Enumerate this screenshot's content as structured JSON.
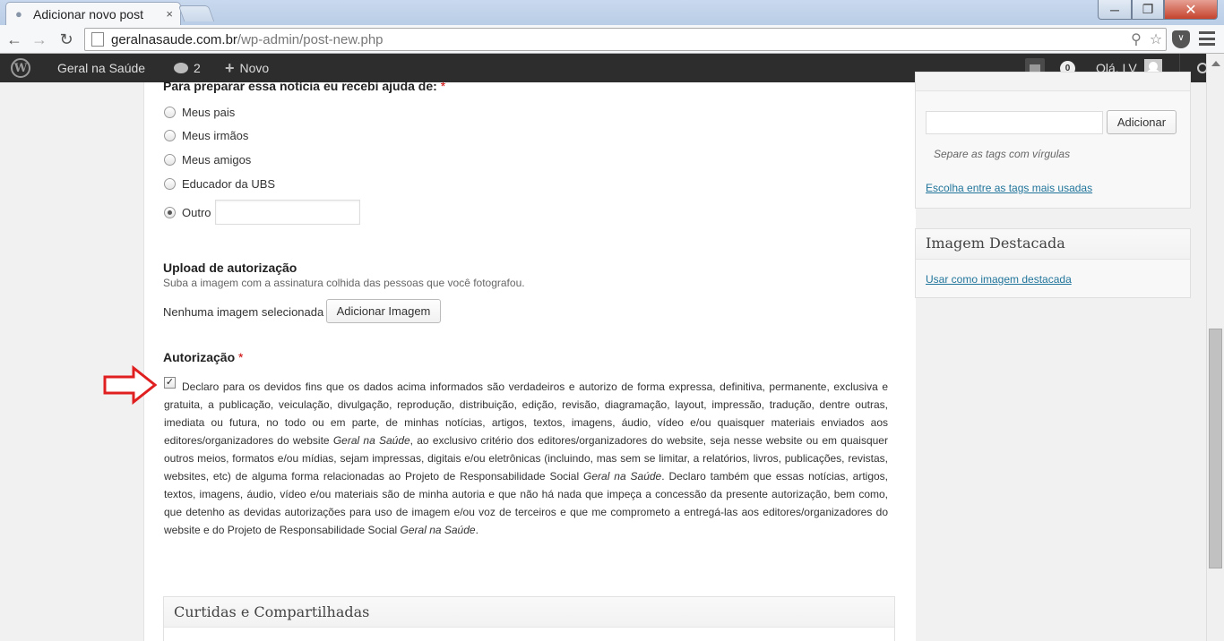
{
  "browser": {
    "tab_title": "Adicionar novo post",
    "tab_close": "×",
    "url_domain": "geralnasaude.com.br",
    "url_path": "/wp-admin/post-new.php"
  },
  "adminbar": {
    "site_name": "Geral na Saúde",
    "comments_count": "2",
    "new_label": "Novo",
    "notification_count": "0",
    "greeting": "Olá, LV"
  },
  "form": {
    "q1": {
      "label": "Para preparar essa notícia eu recebi ajuda de:",
      "required_mark": "*",
      "options": [
        "Meus pais",
        "Meus irmãos",
        "Meus amigos",
        "Educador da UBS",
        "Outro"
      ],
      "selected": "Outro"
    },
    "upload": {
      "label": "Upload de autorização",
      "description": "Suba a imagem com a assinatura colhida das pessoas que você fotografou.",
      "status": "Nenhuma imagem selecionada",
      "button": "Adicionar Imagem"
    },
    "authorization": {
      "label": "Autorização",
      "required_mark": "*",
      "checked": true,
      "text_1": "Declaro para os devidos fins que os dados acima informados são verdadeiros e autorizo de forma expressa, definitiva, permanente, exclusiva e gratuita, a publicação, veiculação, divulgação, reprodução, distribuição, edição, revisão, diagramação, layout, impressão, tradução, dentre outras, imediata ou futura, no todo ou em parte, de minhas notícias, artigos, textos, imagens, áudio, vídeo e/ou quaisquer materiais enviados aos editores/organizadores do website ",
      "site_name_1": "Geral na Saúde",
      "text_2": ", ao exclusivo critério dos editores/organizadores do website, seja nesse website ou em quaisquer outros meios, formatos e/ou mídias, sejam impressas, digitais e/ou eletrônicas (incluindo, mas sem se limitar, a relatórios, livros, publicações, revistas, websites, etc) de alguma forma relacionadas ao Projeto de Responsabilidade Social ",
      "site_name_2": "Geral na Saúde",
      "text_3": ". Declaro também que essas notícias, artigos, textos, imagens, áudio, vídeo e/ou materiais são de minha autoria e que não há nada que impeça a concessão da presente autorização, bem como, que detenho as devidas autorizações para uso de imagem e/ou voz de terceiros e que me comprometo a entregá-las aos editores/organizadores do website e do Projeto de Responsabilidade Social ",
      "site_name_3": "Geral na Saúde",
      "text_4": "."
    },
    "curtidas_title": "Curtidas e Compartilhadas"
  },
  "sidebar": {
    "tags": {
      "add_button": "Adicionar",
      "hint": "Separe as tags com vírgulas",
      "popular_link": "Escolha entre as tags mais usadas"
    },
    "featured": {
      "title": "Imagem Destacada",
      "link": "Usar como imagem destacada"
    }
  },
  "colors": {
    "admin_bar": "#2d2d2d",
    "link": "#21759b",
    "arrow": "#e02020"
  }
}
